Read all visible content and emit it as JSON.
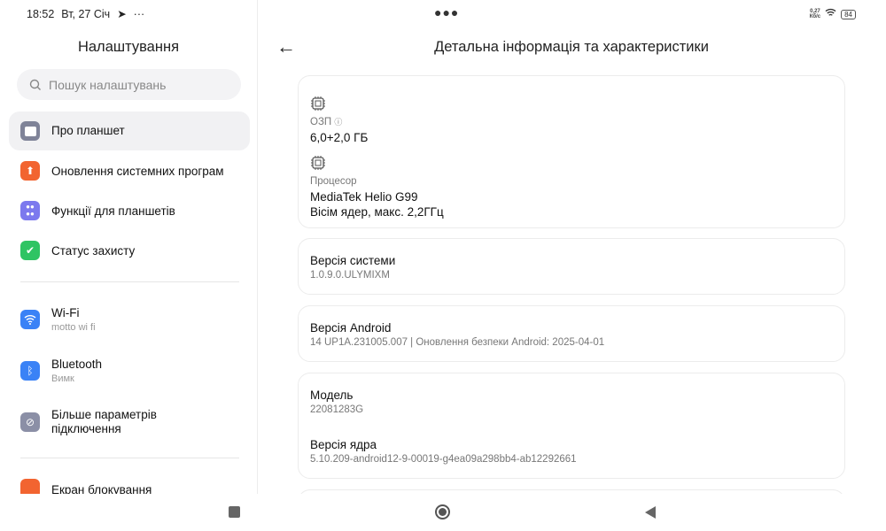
{
  "status": {
    "time": "18:52",
    "date": "Вт, 27 Січ",
    "net_speed": "0,27",
    "net_unit": "Кб/с",
    "battery": "84"
  },
  "sidebar": {
    "title": "Налаштування",
    "search_placeholder": "Пошук налаштувань",
    "items": [
      {
        "label": "Про планшет",
        "color": "#7f8398"
      },
      {
        "label": "Оновлення системних програм",
        "color": "#f26430"
      },
      {
        "label": "Функції для планшетів",
        "color": "#7c79ee"
      },
      {
        "label": "Статус захисту",
        "color": "#2fc463"
      },
      {
        "label": "Wi-Fi",
        "sub": "motto wi fi",
        "color": "#3a82f6"
      },
      {
        "label": "Bluetooth",
        "sub": "Вимк",
        "color": "#3a82f6"
      },
      {
        "label": "Більше параметрів підключення",
        "color": "#8b8fa6"
      },
      {
        "label": "Екран блокування",
        "color": "#f26430"
      }
    ]
  },
  "main": {
    "title": "Детальна інформація та характеристики",
    "ram_label": "ОЗП",
    "ram_value": "6,0+2,0 ГБ",
    "cpu_label": "Процесор",
    "cpu_value1": "MediaTek Helio G99",
    "cpu_value2": "Вісім ядер, макс. 2,2ГГц",
    "sys_label": "Версія системи",
    "sys_value": "1.0.9.0.ULYMIXM",
    "android_label": "Версія Android",
    "android_value": "14 UP1A.231005.007 | Оновлення безпеки Android: 2025-04-01",
    "model_label": "Модель",
    "model_value": "22081283G",
    "kernel_label": "Версія ядра",
    "kernel_value": "5.10.209-android12-9-00019-g4ea09a298bb4-ab12292661"
  }
}
